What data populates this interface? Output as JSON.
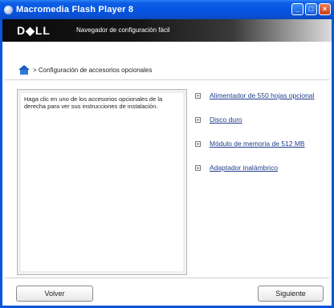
{
  "window": {
    "title": "Macromedia Flash Player 8",
    "minimize": "_",
    "maximize": "□",
    "close": "×"
  },
  "header": {
    "logo": "D◆LL",
    "subtitle": "Navegador de configuración fácil"
  },
  "breadcrumb": {
    "text": "> Configuración de accesorios opcionales"
  },
  "instructions": {
    "text": "Haga clic en uno de los accesorios opcionales de la derecha para ver sus instrucciones de instalación."
  },
  "options": [
    {
      "label": "Alimentador de 550 hojas opcional"
    },
    {
      "label": "Disco duro"
    },
    {
      "label": "Módulo de memoria de 512 MB"
    },
    {
      "label": "Adaptador inalámbrico"
    }
  ],
  "footer": {
    "back": "Volver",
    "next": "Siguiente"
  }
}
